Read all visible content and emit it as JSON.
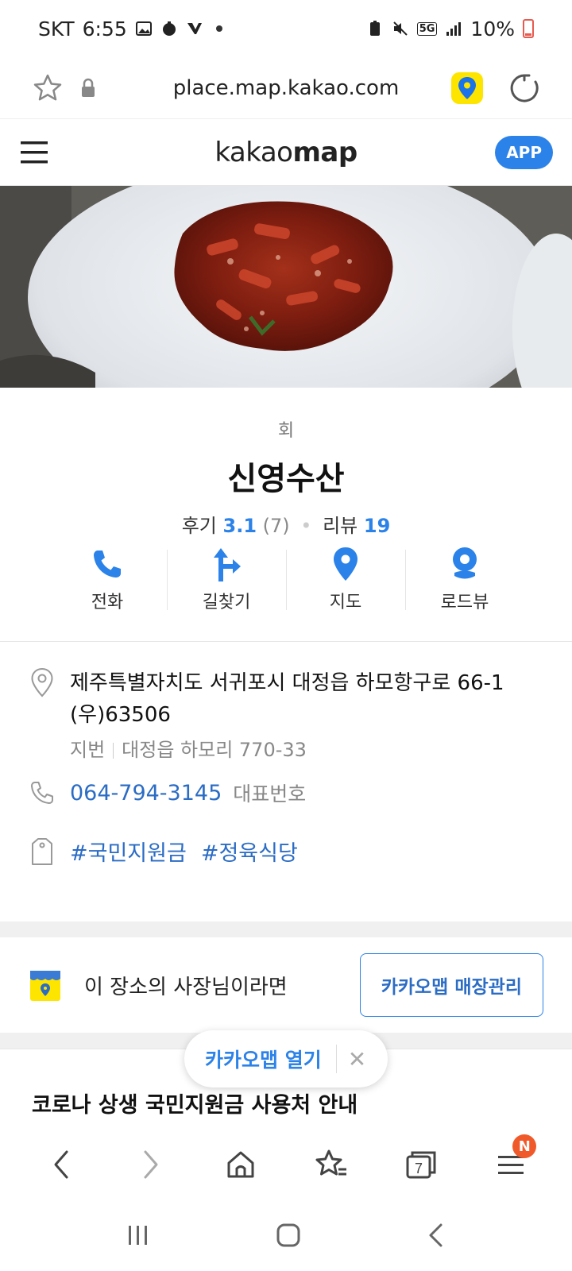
{
  "status_bar": {
    "carrier": "SKT",
    "time": "6:55",
    "network": "5G",
    "battery": "10%"
  },
  "browser": {
    "url": "place.map.kakao.com",
    "tab_count": "7",
    "menu_badge": "N"
  },
  "header": {
    "logo_light": "kakao",
    "logo_bold": "map",
    "app_button": "APP"
  },
  "place": {
    "category": "회",
    "name": "신영수산",
    "review_label": "후기",
    "review_score": "3.1",
    "review_count": "(7)",
    "blog_label": "리뷰",
    "blog_count": "19"
  },
  "actions": [
    {
      "label": "전화",
      "icon": "phone-icon"
    },
    {
      "label": "길찾기",
      "icon": "directions-icon"
    },
    {
      "label": "지도",
      "icon": "map-pin-icon"
    },
    {
      "label": "로드뷰",
      "icon": "roadview-icon"
    }
  ],
  "details": {
    "address": "제주특별자치도 서귀포시 대정읍 하모항구로 66-1",
    "postal": "(우)63506",
    "jibun_label": "지번",
    "jibun": "대정읍 하모리 770-33",
    "phone": "064-794-3145",
    "phone_label": "대표번호",
    "tags": [
      "#국민지원금",
      "#정육식당"
    ]
  },
  "owner": {
    "text": "이 장소의 사장님이라면",
    "button": "카카오맵 매장관리"
  },
  "notice": {
    "title": "코로나 상생 국민지원금 사용처 안내"
  },
  "floating": {
    "open_label": "카카오맵 열기",
    "close_label": "✕"
  },
  "colors": {
    "accent": "#2b82e8",
    "link": "#2b6cc4",
    "kakao_yellow": "#fee500",
    "badge": "#f05a2a"
  }
}
